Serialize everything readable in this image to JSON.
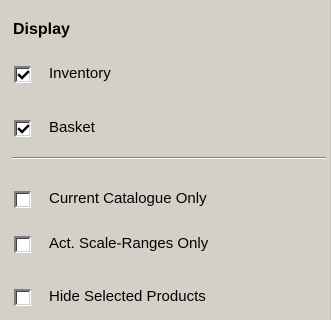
{
  "display": {
    "title": "Display",
    "options": [
      {
        "label": "Inventory",
        "checked": true
      },
      {
        "label": "Basket",
        "checked": true
      },
      {
        "label": "Current Catalogue Only",
        "checked": false
      },
      {
        "label": "Act. Scale-Ranges Only",
        "checked": false
      },
      {
        "label": "Hide Selected Products",
        "checked": false
      }
    ]
  },
  "colors": {
    "panel_background": "#d4d0c8",
    "checkbox_background": "#ffffff",
    "check_mark": "#000000"
  },
  "icons": {
    "checked": "check-mark-icon"
  }
}
